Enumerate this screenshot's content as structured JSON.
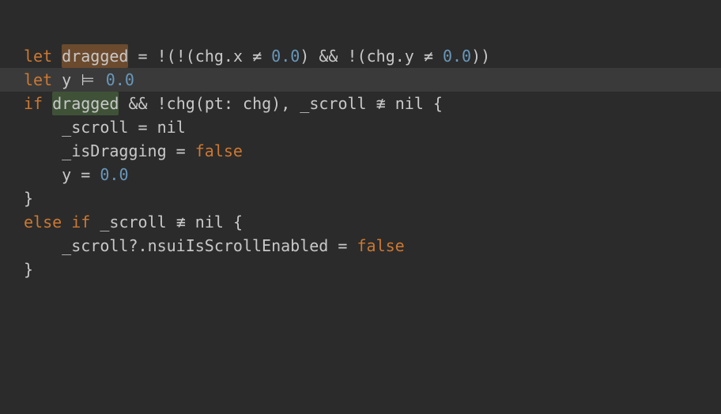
{
  "keywords": {
    "let": "let",
    "if": "if",
    "else": "else"
  },
  "identifiers": {
    "dragged": "dragged",
    "chg": "chg",
    "x": "x",
    "y": "y",
    "pt": "pt",
    "scroll": "_scroll",
    "isDragging": "_isDragging",
    "nsuiIsScrollEnabled": "nsuiIsScrollEnabled"
  },
  "numbers": {
    "zero": "0.0"
  },
  "literals": {
    "nil": "nil",
    "false": "false"
  },
  "operators": {
    "assign": "=",
    "not": "!",
    "ne": "≠",
    "equiv": "⊨",
    "and": "&&",
    "ncongr": "≇",
    "nequiv": "≢",
    "dot": ".",
    "comma": ",",
    "colon": ":",
    "qmark": "?",
    "lparen": "(",
    "rparen": ")",
    "lbrace": "{",
    "rbrace": "}"
  },
  "indent": {
    "one": "    "
  }
}
